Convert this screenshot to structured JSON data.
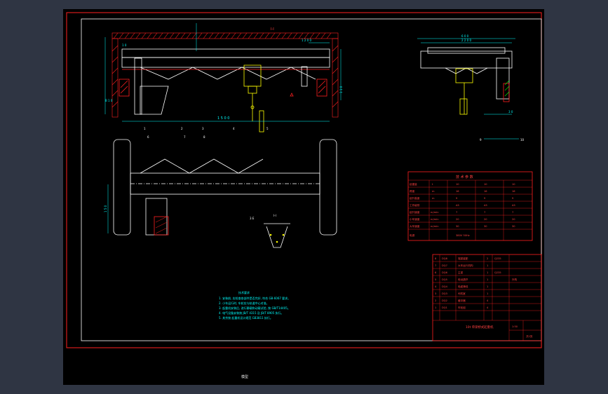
{
  "colors": {
    "background": "#2f3543",
    "paper": "#000000",
    "frame": "#ff2020",
    "geometry": "#ffffff",
    "dimension": "#00ffff",
    "table_line": "#ff2020",
    "table_text": "#ff4040",
    "hatch": "#ff2020",
    "hoist": "#ffff00",
    "notes_text": "#00ffff"
  },
  "elevation_view": {
    "top_dim": "I-I",
    "span_dim": "1 5 0 0",
    "height_dim": "1 1 0",
    "rail_dim": "1 2 0 0",
    "left_dim_a": "1 0",
    "left_dim_b": "B 1 0",
    "callouts": [
      "1",
      "2",
      "3",
      "4",
      "5"
    ]
  },
  "side_view": {
    "width_dim": "2 2 0 0",
    "top_dim": "6 0 0",
    "bottom_dim": "3 0",
    "callouts": [
      "9",
      "10"
    ]
  },
  "plan_view": {
    "callouts": [
      "6",
      "7",
      "8"
    ],
    "left_dim": "1 5 0"
  },
  "section_view": {
    "label": "I-I",
    "mark": "3 E"
  },
  "notes": {
    "title": "技术要求",
    "lines": [
      "1. 安装前, 应检查各部件是否完好, 符合 GB-6067 要求。",
      "2. 小车运行时, 车轮应与轨道中心对准。",
      "3. 起重机安装后, 进行静载和动载试验, 按 GB/T14405。",
      "4. 电气设备安装按 JB/T 4315 及 JB/T 8905 执行。",
      "5. 其余按 起重机设计规范 GB3811 执行。"
    ]
  },
  "parameter_table": {
    "title": "技 术 参 数",
    "rows": [
      [
        "起重量",
        "t",
        "10",
        "10",
        "10"
      ],
      [
        "跨度",
        "m",
        "16",
        "16",
        "16"
      ],
      [
        "起升高度",
        "m",
        "9",
        "9",
        "9"
      ],
      [
        "工作级别",
        "",
        "A5",
        "A5",
        "A5"
      ],
      [
        "起升速度",
        "m/min",
        "7",
        "7",
        "7"
      ],
      [
        "小车速度",
        "m/min",
        "20",
        "20",
        "20"
      ],
      [
        "大车速度",
        "m/min",
        "30",
        "30",
        "30"
      ],
      [
        "电源",
        "",
        "380V 50Hz",
        "",
        ""
      ]
    ]
  },
  "parts_table": {
    "rows": [
      [
        "8",
        "DQ8",
        "端梁装配",
        "2",
        "Q235",
        ""
      ],
      [
        "7",
        "DQ7",
        "大车运行机构",
        "1",
        "",
        ""
      ],
      [
        "6",
        "DQ6",
        "主梁",
        "1",
        "Q235",
        ""
      ],
      [
        "5",
        "DQ5",
        "电动葫芦",
        "1",
        "",
        "外购"
      ],
      [
        "4",
        "DQ4",
        "电缆滑线",
        "1",
        "",
        ""
      ],
      [
        "3",
        "DQ3",
        "司机室",
        "1",
        "",
        ""
      ],
      [
        "2",
        "DQ2",
        "缓冲器",
        "4",
        "",
        ""
      ],
      [
        "1",
        "DQ1",
        "车轮组",
        "4",
        "",
        ""
      ]
    ],
    "title_block": {
      "drawing_title": "10t 单梁桥式起重机",
      "scale": "1:50",
      "sheet": "共1张"
    }
  },
  "status_label": "模型"
}
